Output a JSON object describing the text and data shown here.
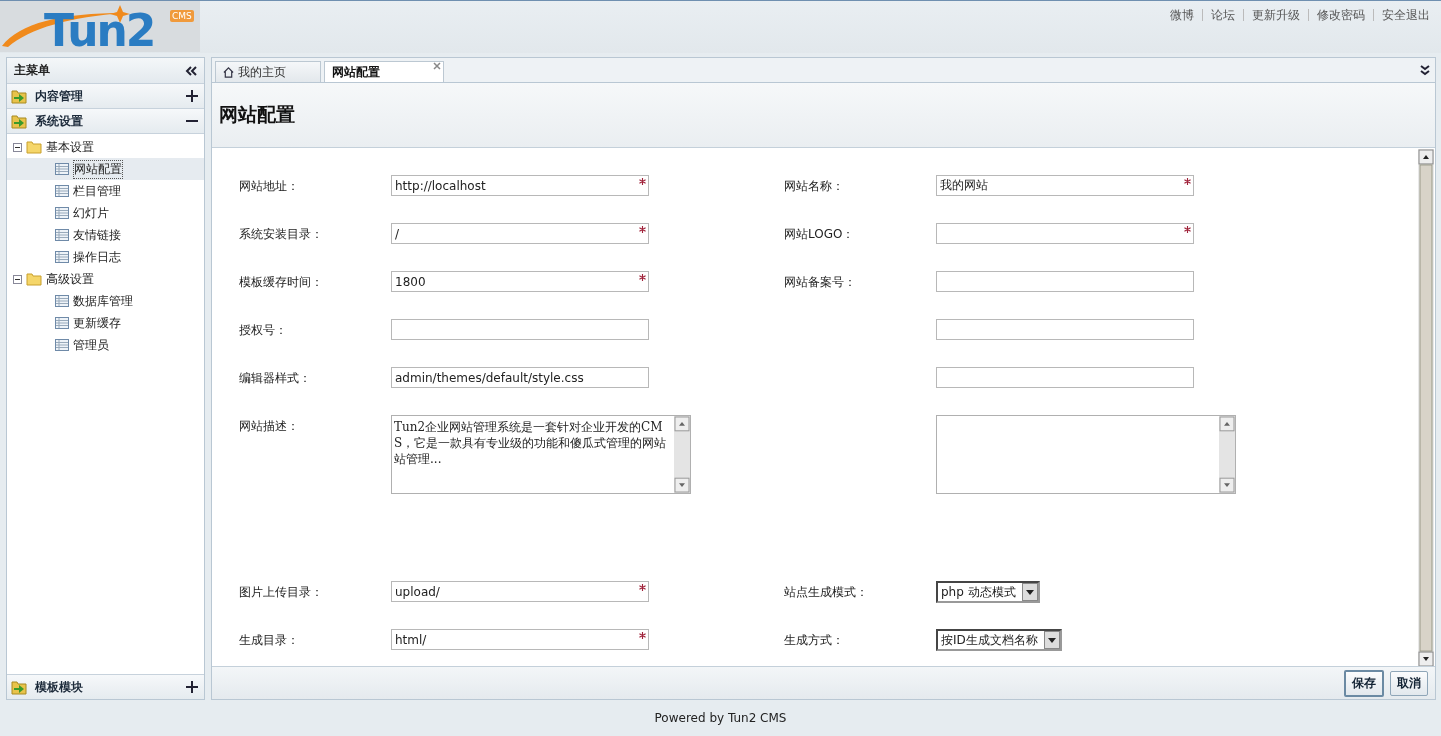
{
  "logo": {
    "text": "Tun2",
    "badge": "CMS"
  },
  "top_links": [
    "微博",
    "论坛",
    "更新升级",
    "修改密码",
    "安全退出"
  ],
  "sidebar": {
    "title": "主菜单",
    "sections": [
      {
        "label": "内容管理",
        "expanded": false
      },
      {
        "label": "系统设置",
        "expanded": true,
        "children": [
          {
            "label": "基本设置",
            "expanded": true,
            "children": [
              {
                "label": "网站配置",
                "selected": true
              },
              {
                "label": "栏目管理",
                "selected": false
              },
              {
                "label": "幻灯片",
                "selected": false
              },
              {
                "label": "友情链接",
                "selected": false
              },
              {
                "label": "操作日志",
                "selected": false
              }
            ]
          },
          {
            "label": "高级设置",
            "expanded": true,
            "children": [
              {
                "label": "数据库管理",
                "selected": false
              },
              {
                "label": "更新缓存",
                "selected": false
              },
              {
                "label": "管理员",
                "selected": false
              }
            ]
          }
        ]
      },
      {
        "label": "模板模块",
        "expanded": false
      }
    ]
  },
  "tabs": [
    {
      "label": "我的主页",
      "selected": false,
      "closable": false
    },
    {
      "label": "网站配置",
      "selected": true,
      "closable": true
    }
  ],
  "page_title": "网站配置",
  "form": {
    "rows": [
      {
        "kind": "input",
        "left": {
          "label": "网站地址：",
          "kind": "input",
          "value": "http://localhost",
          "required": true
        },
        "right": {
          "label": "网站名称：",
          "kind": "input",
          "value": "我的网站",
          "required": true
        }
      },
      {
        "kind": "input",
        "left": {
          "label": "系统安装目录：",
          "kind": "input",
          "value": "/",
          "required": true
        },
        "right": {
          "label": "网站LOGO：",
          "kind": "input",
          "required": true
        }
      },
      {
        "kind": "input",
        "left": {
          "label": "模板缓存时间：",
          "kind": "input",
          "value": "1800",
          "required": true
        },
        "right": {
          "label": "网站备案号：",
          "kind": "input",
          "required": false
        }
      },
      {
        "kind": "input",
        "left": {
          "label": "授权号：",
          "kind": "input",
          "required": false
        },
        "right": {
          "kind": "input",
          "required": false
        }
      },
      {
        "kind": "input",
        "left": {
          "label": "编辑器样式：",
          "kind": "input",
          "value": "admin/themes/default/style.css",
          "required": false
        },
        "right": {
          "kind": "input",
          "required": false
        }
      },
      {
        "kind": "textarea",
        "left": {
          "label": "网站描述：",
          "kind": "textarea",
          "value": "Tun2企业网站管理系统是一套针对企业开发的CMS，它是一款具有专业级的功能和傻瓜式管理的网站站管理..."
        },
        "right": {
          "kind": "textarea"
        }
      },
      {
        "kind": "input",
        "left": {
          "label": "图片上传目录：",
          "kind": "input",
          "value": "upload/",
          "required": true
        },
        "right": {
          "label": "站点生成模式：",
          "kind": "select",
          "value": "php 动态模式"
        }
      },
      {
        "kind": "input",
        "left": {
          "label": "生成目录：",
          "kind": "input",
          "value": "html/",
          "required": true
        },
        "right": {
          "label": "生成方式：",
          "kind": "select",
          "value": "按ID生成文档名称"
        }
      }
    ]
  },
  "buttons": [
    "保存",
    "取消"
  ],
  "footer": "Powered by Tun2 CMS"
}
